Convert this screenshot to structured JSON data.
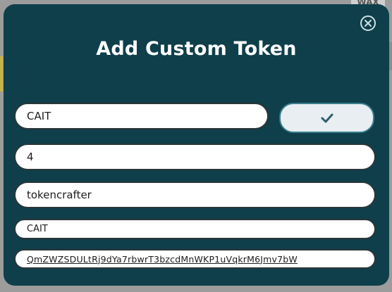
{
  "background": {
    "logo_text": "WAX"
  },
  "modal": {
    "title": "Add Custom Token",
    "fields": {
      "symbol": "CAIT",
      "precision": "4",
      "contract": "tokencrafter",
      "name": "CAIT",
      "logo_hash": "QmZWZSDULtRj9dYa7rbwrT3bzcdMnWKP1uVqkrM6Jmv7bW"
    },
    "close_icon": "close-circle-icon",
    "confirm_icon": "checkmark-icon"
  },
  "colors": {
    "modal_background": "#0e3f4b",
    "confirm_button": "#e8eef2",
    "confirm_border": "#3a7d8c",
    "checkmark": "#2f5d6b"
  }
}
